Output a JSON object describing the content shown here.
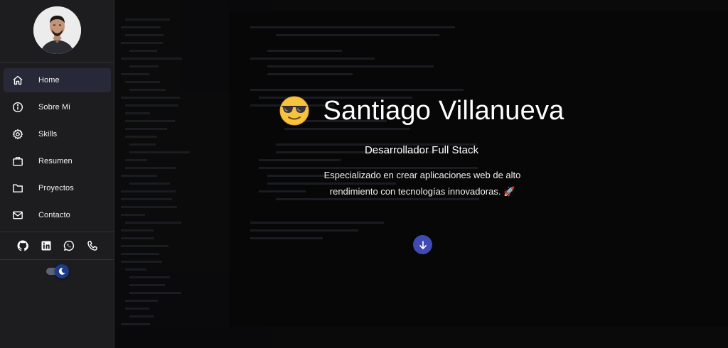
{
  "sidebar": {
    "avatar_icon": "profile-photo",
    "nav": [
      {
        "label": "Home",
        "icon": "home-icon",
        "active": true
      },
      {
        "label": "Sobre Mi",
        "icon": "info-icon",
        "active": false
      },
      {
        "label": "Skills",
        "icon": "gear-icon",
        "active": false
      },
      {
        "label": "Resumen",
        "icon": "briefcase-icon",
        "active": false
      },
      {
        "label": "Proyectos",
        "icon": "folder-icon",
        "active": false
      },
      {
        "label": "Contacto",
        "icon": "mail-icon",
        "active": false
      }
    ],
    "social": [
      "github-icon",
      "linkedin-icon",
      "whatsapp-icon",
      "phone-icon"
    ],
    "theme_toggle": {
      "icon": "moon-icon",
      "dark_mode": true
    }
  },
  "hero": {
    "emoji": "sunglasses-emoji",
    "title": "Santiago Villanueva",
    "subtitle": "Desarrollador Full Stack",
    "description": "Especializado en crear aplicaciones web de alto rendimiento con tecnologías innovadoras. 🚀",
    "scroll_icon": "arrow-down-icon"
  },
  "colors": {
    "sidebar_bg": "#1d1d1f",
    "active_nav_bg": "#272838",
    "accent": "#3f4bb3",
    "main_bg": "#070708"
  }
}
